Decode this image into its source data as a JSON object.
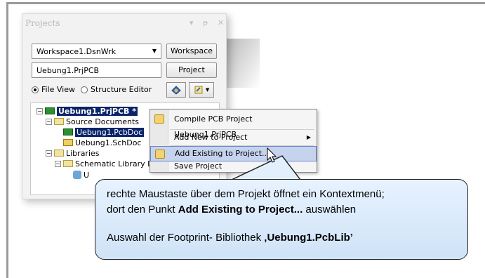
{
  "panel": {
    "title": "Projects",
    "title_icons": "▾ ᵽ ✕",
    "workspace_combo": "Workspace1.DsnWrk",
    "workspace_button": "Workspace",
    "project_field": "Uebung1.PrjPCB",
    "project_button": "Project",
    "view_options": [
      {
        "label": "File View",
        "selected": true
      },
      {
        "label": "Structure Editor",
        "selected": false
      }
    ]
  },
  "tree": {
    "items": [
      {
        "label": "Uebung1.PrjPCB *",
        "level": 0,
        "icon": "pcb-project-icon",
        "expander": "−",
        "selected": true
      },
      {
        "label": "Source Documents",
        "level": 1,
        "icon": "folder-icon",
        "expander": "−"
      },
      {
        "label": "Uebung1.PcbDoc",
        "level": 2,
        "icon": "pcb-doc-icon",
        "selected": true
      },
      {
        "label": "Uebung1.SchDoc",
        "level": 2,
        "icon": "sch-doc-icon"
      },
      {
        "label": "Libraries",
        "level": 1,
        "icon": "folder-icon",
        "expander": "−"
      },
      {
        "label": "Schematic Library Do",
        "level": 2,
        "icon": "folder-icon",
        "expander": "−"
      },
      {
        "label": "U",
        "level": 3,
        "icon": "schlib-icon"
      }
    ]
  },
  "context_menu": {
    "items": [
      {
        "label": "Compile PCB Project Uebung1.PrjPCB",
        "icon": "compile-icon"
      },
      {
        "label": "Add New to Project",
        "submenu": true
      },
      {
        "label": "Add Existing to Project...",
        "icon": "add-existing-icon",
        "highlighted": true
      },
      {
        "label": "Save Project"
      }
    ],
    "submenu_arrow": "▶"
  },
  "callout": {
    "line1": "rechte Maustaste über dem Projekt öffnet ein Kontextmenü;",
    "line2_prefix": "dort den Punkt ",
    "line2_bold": "Add Existing to Project...",
    "line2_suffix": " auswählen",
    "line3_prefix": "Auswahl der Footprint- Bibliothek ",
    "line3_bold": "‚Uebung1.PcbLib’"
  },
  "colors": {
    "selection": "#0a246a",
    "menu_highlight": "#c6d3ee",
    "callout_fill": "#d8e9fa"
  }
}
